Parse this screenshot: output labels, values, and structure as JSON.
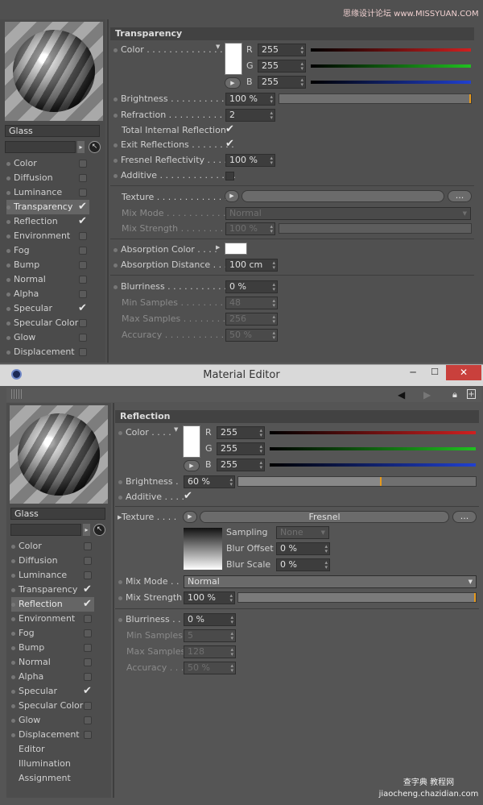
{
  "watermark_top": "思缘设计论坛 www.MISSYUAN.COM",
  "watermark_bottom": "查字典 教程网 jiaocheng.chazidian.com",
  "top": {
    "material_name": "Glass",
    "section": "Transparency",
    "channels": [
      {
        "label": "Color",
        "checked": false
      },
      {
        "label": "Diffusion",
        "checked": false
      },
      {
        "label": "Luminance",
        "checked": false
      },
      {
        "label": "Transparency",
        "checked": true,
        "active": true
      },
      {
        "label": "Reflection",
        "checked": true
      },
      {
        "label": "Environment",
        "checked": false
      },
      {
        "label": "Fog",
        "checked": false
      },
      {
        "label": "Bump",
        "checked": false
      },
      {
        "label": "Normal",
        "checked": false
      },
      {
        "label": "Alpha",
        "checked": false
      },
      {
        "label": "Specular",
        "checked": true
      },
      {
        "label": "Specular Color",
        "checked": false
      },
      {
        "label": "Glow",
        "checked": false
      },
      {
        "label": "Displacement",
        "checked": false
      }
    ],
    "color_label": "Color",
    "r": "255",
    "g": "255",
    "b": "255",
    "r_label": "R",
    "g_label": "G",
    "b_label": "B",
    "brightness_label": "Brightness",
    "brightness": "100 %",
    "brightness_fraction": 1.0,
    "refraction_label": "Refraction",
    "refraction": "2",
    "tir_label": "Total Internal Reflection",
    "exit_label": "Exit Reflections",
    "fresnel_label": "Fresnel Reflectivity",
    "fresnel": "100 %",
    "additive_label": "Additive",
    "texture_label": "Texture",
    "texture_more": "...",
    "mixmode_label": "Mix Mode",
    "mixmode": "Normal",
    "mixstrength_label": "Mix Strength",
    "mixstrength": "100 %",
    "abscolor_label": "Absorption Color",
    "absdist_label": "Absorption Distance",
    "absdist": "100 cm",
    "blurriness_label": "Blurriness",
    "blurriness": "0 %",
    "minsamples_label": "Min Samples",
    "minsamples": "48",
    "maxsamples_label": "Max Samples",
    "maxsamples": "256",
    "accuracy_label": "Accuracy",
    "accuracy": "50 %"
  },
  "bottom": {
    "window_title": "Material Editor",
    "material_name": "Glass",
    "section": "Reflection",
    "channels": [
      {
        "label": "Color",
        "checked": false
      },
      {
        "label": "Diffusion",
        "checked": false
      },
      {
        "label": "Luminance",
        "checked": false
      },
      {
        "label": "Transparency",
        "checked": true
      },
      {
        "label": "Reflection",
        "checked": true,
        "active": true
      },
      {
        "label": "Environment",
        "checked": false
      },
      {
        "label": "Fog",
        "checked": false
      },
      {
        "label": "Bump",
        "checked": false
      },
      {
        "label": "Normal",
        "checked": false
      },
      {
        "label": "Alpha",
        "checked": false
      },
      {
        "label": "Specular",
        "checked": true
      },
      {
        "label": "Specular Color",
        "checked": false
      },
      {
        "label": "Glow",
        "checked": false
      },
      {
        "label": "Displacement",
        "checked": false
      }
    ],
    "extra_items": [
      "Editor",
      "Illumination",
      "Assignment"
    ],
    "color_label": "Color",
    "r": "255",
    "g": "255",
    "b": "255",
    "r_label": "R",
    "g_label": "G",
    "b_label": "B",
    "brightness_label": "Brightness",
    "brightness": "60 %",
    "brightness_fraction": 0.6,
    "additive_label": "Additive",
    "texture_label": "Texture",
    "texture_name": "Fresnel",
    "texture_more": "...",
    "sampling_label": "Sampling",
    "sampling": "None",
    "bluroffset_label": "Blur Offset",
    "bluroffset": "0 %",
    "blurscale_label": "Blur Scale",
    "blurscale": "0 %",
    "mixmode_label": "Mix Mode",
    "mixmode": "Normal",
    "mixstrength_label": "Mix Strength",
    "mixstrength": "100 %",
    "mixstrength_fraction": 1.0,
    "blurriness_label": "Blurriness",
    "blurriness": "0 %",
    "minsamples_label": "Min Samples",
    "minsamples": "5",
    "maxsamples_label": "Max Samples",
    "maxsamples": "128",
    "accuracy_label": "Accuracy",
    "accuracy": "50 %"
  },
  "colors": {
    "accent": "#e79a1c",
    "close": "#c9403c",
    "red": "#d02020",
    "green": "#20c020",
    "blue": "#2040d0"
  }
}
